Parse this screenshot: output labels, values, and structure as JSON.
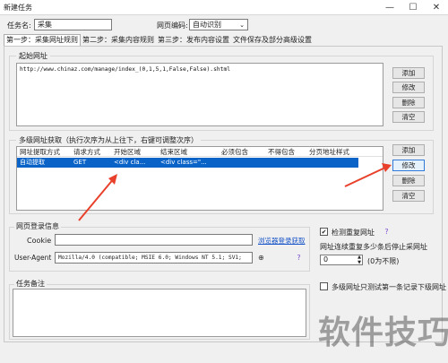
{
  "window": {
    "title": "新建任务",
    "minimize": "—",
    "maximize": "☐",
    "close": "✕"
  },
  "task_name": {
    "label": "任务名:",
    "value": "采集"
  },
  "encoding": {
    "label": "网页编码:",
    "value": "自动识别"
  },
  "tabs": [
    {
      "label": "第一步：采集网址规则"
    },
    {
      "label": "第二步：采集内容规则"
    },
    {
      "label": "第三步：发布内容设置"
    },
    {
      "label": "文件保存及部分高级设置"
    }
  ],
  "start_url": {
    "title": "起始网址",
    "value": "http://www.chinaz.com/manage/index_(0,1,5,1,False,False).shtml",
    "buttons": {
      "add": "添加",
      "edit": "修改",
      "delete": "删除",
      "clear": "清空"
    }
  },
  "multi_url": {
    "title": "多级网址获取（执行次序为从上往下，右键可调整次序）",
    "columns": [
      "网址提取方式",
      "请求方式",
      "开始区域",
      "结束区域",
      "必须包含",
      "不得包含",
      "分页地址样式"
    ],
    "rows": [
      {
        "method": "自动提取",
        "request": "GET",
        "start": "<div cla...",
        "end": "<div class=\"...",
        "must": "",
        "must_not": "",
        "paging": ""
      }
    ],
    "buttons": {
      "add": "添加",
      "edit": "修改",
      "delete": "删除",
      "clear": "清空"
    }
  },
  "login": {
    "title": "网页登录信息",
    "cookie_label": "Cookie",
    "cookie_value": "",
    "browser_link": "浏览器登录获取",
    "ua_label": "User-Agent",
    "ua_value": "Mozilla/4.0 (compatible; MSIE 6.0; Windows NT 5.1; SV1;"
  },
  "options": {
    "dedupe_label": "检测重复网址",
    "dedupe_checked": true,
    "stop_label": "网址连续重复多少条后停止采网址",
    "stop_value": "0",
    "stop_hint": "(0为不限)",
    "test_label": "多级网址只测试第一条记录下级网址",
    "test_checked": false
  },
  "notes": {
    "title": "任务备注",
    "value": ""
  },
  "watermark": "软件技巧",
  "colors": {
    "selection": "#0a64c8",
    "arrow": "#e8402a",
    "link": "#1a56c8"
  }
}
